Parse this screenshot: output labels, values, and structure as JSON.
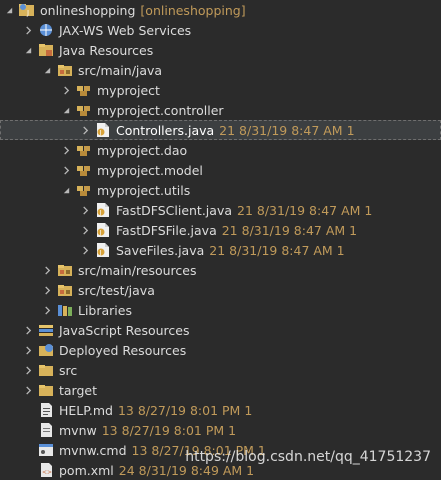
{
  "tree": [
    {
      "label": "onlineshopping",
      "meta": "[onlineshopping]",
      "icon": "project-folder-icon",
      "twisty": "expanded",
      "depth": 0
    },
    {
      "label": "JAX-WS Web Services",
      "meta": "",
      "icon": "web-services-icon",
      "twisty": "collapsed",
      "depth": 1
    },
    {
      "label": "Java Resources",
      "meta": "",
      "icon": "java-resources-icon",
      "twisty": "expanded",
      "depth": 1
    },
    {
      "label": "src/main/java",
      "meta": "",
      "icon": "source-folder-icon",
      "twisty": "expanded",
      "depth": 2
    },
    {
      "label": "myproject",
      "meta": "",
      "icon": "package-icon",
      "twisty": "collapsed",
      "depth": 3
    },
    {
      "label": "myproject.controller",
      "meta": "",
      "icon": "package-icon",
      "twisty": "expanded",
      "depth": 3
    },
    {
      "label": "Controllers.java",
      "meta": "21  8/31/19 8:47 AM  1",
      "icon": "java-file-icon",
      "twisty": "collapsed",
      "depth": 4,
      "selected": true
    },
    {
      "label": "myproject.dao",
      "meta": "",
      "icon": "package-icon",
      "twisty": "collapsed",
      "depth": 3
    },
    {
      "label": "myproject.model",
      "meta": "",
      "icon": "package-icon",
      "twisty": "collapsed",
      "depth": 3
    },
    {
      "label": "myproject.utils",
      "meta": "",
      "icon": "package-icon",
      "twisty": "expanded",
      "depth": 3
    },
    {
      "label": "FastDFSClient.java",
      "meta": "21  8/31/19 8:47 AM  1",
      "icon": "java-file-icon",
      "twisty": "collapsed",
      "depth": 4
    },
    {
      "label": "FastDFSFile.java",
      "meta": "21  8/31/19 8:47 AM  1",
      "icon": "java-file-icon",
      "twisty": "collapsed",
      "depth": 4
    },
    {
      "label": "SaveFiles.java",
      "meta": "21  8/31/19 8:47 AM  1",
      "icon": "java-file-icon",
      "twisty": "collapsed",
      "depth": 4
    },
    {
      "label": "src/main/resources",
      "meta": "",
      "icon": "source-folder-icon",
      "twisty": "collapsed",
      "depth": 2
    },
    {
      "label": "src/test/java",
      "meta": "",
      "icon": "source-folder-icon",
      "twisty": "collapsed",
      "depth": 2
    },
    {
      "label": "Libraries",
      "meta": "",
      "icon": "libraries-icon",
      "twisty": "collapsed",
      "depth": 2
    },
    {
      "label": "JavaScript Resources",
      "meta": "",
      "icon": "javascript-resources-icon",
      "twisty": "collapsed",
      "depth": 1
    },
    {
      "label": "Deployed Resources",
      "meta": "",
      "icon": "deployed-resources-icon",
      "twisty": "collapsed",
      "depth": 1
    },
    {
      "label": "src",
      "meta": "",
      "icon": "folder-icon",
      "twisty": "collapsed",
      "depth": 1
    },
    {
      "label": "target",
      "meta": "",
      "icon": "folder-icon",
      "twisty": "collapsed",
      "depth": 1
    },
    {
      "label": "HELP.md",
      "meta": "13  8/27/19 8:01 PM  1",
      "icon": "markdown-file-icon",
      "twisty": "none",
      "depth": 1
    },
    {
      "label": "mvnw",
      "meta": "13  8/27/19 8:01 PM  1",
      "icon": "text-file-icon",
      "twisty": "none",
      "depth": 1
    },
    {
      "label": "mvnw.cmd",
      "meta": "13  8/27/19 8:01 PM  1",
      "icon": "cmd-file-icon",
      "twisty": "none",
      "depth": 1
    },
    {
      "label": "pom.xml",
      "meta": "24  8/31/19 8:49 AM  1",
      "icon": "xml-file-icon",
      "twisty": "none",
      "depth": 1
    }
  ],
  "watermark": "https://blog.csdn.net/qq_41751237",
  "colors": {
    "background": "#2b2b2b",
    "text": "#dcdcdc",
    "meta": "#c09a5a",
    "selection": "#3c3f41"
  }
}
